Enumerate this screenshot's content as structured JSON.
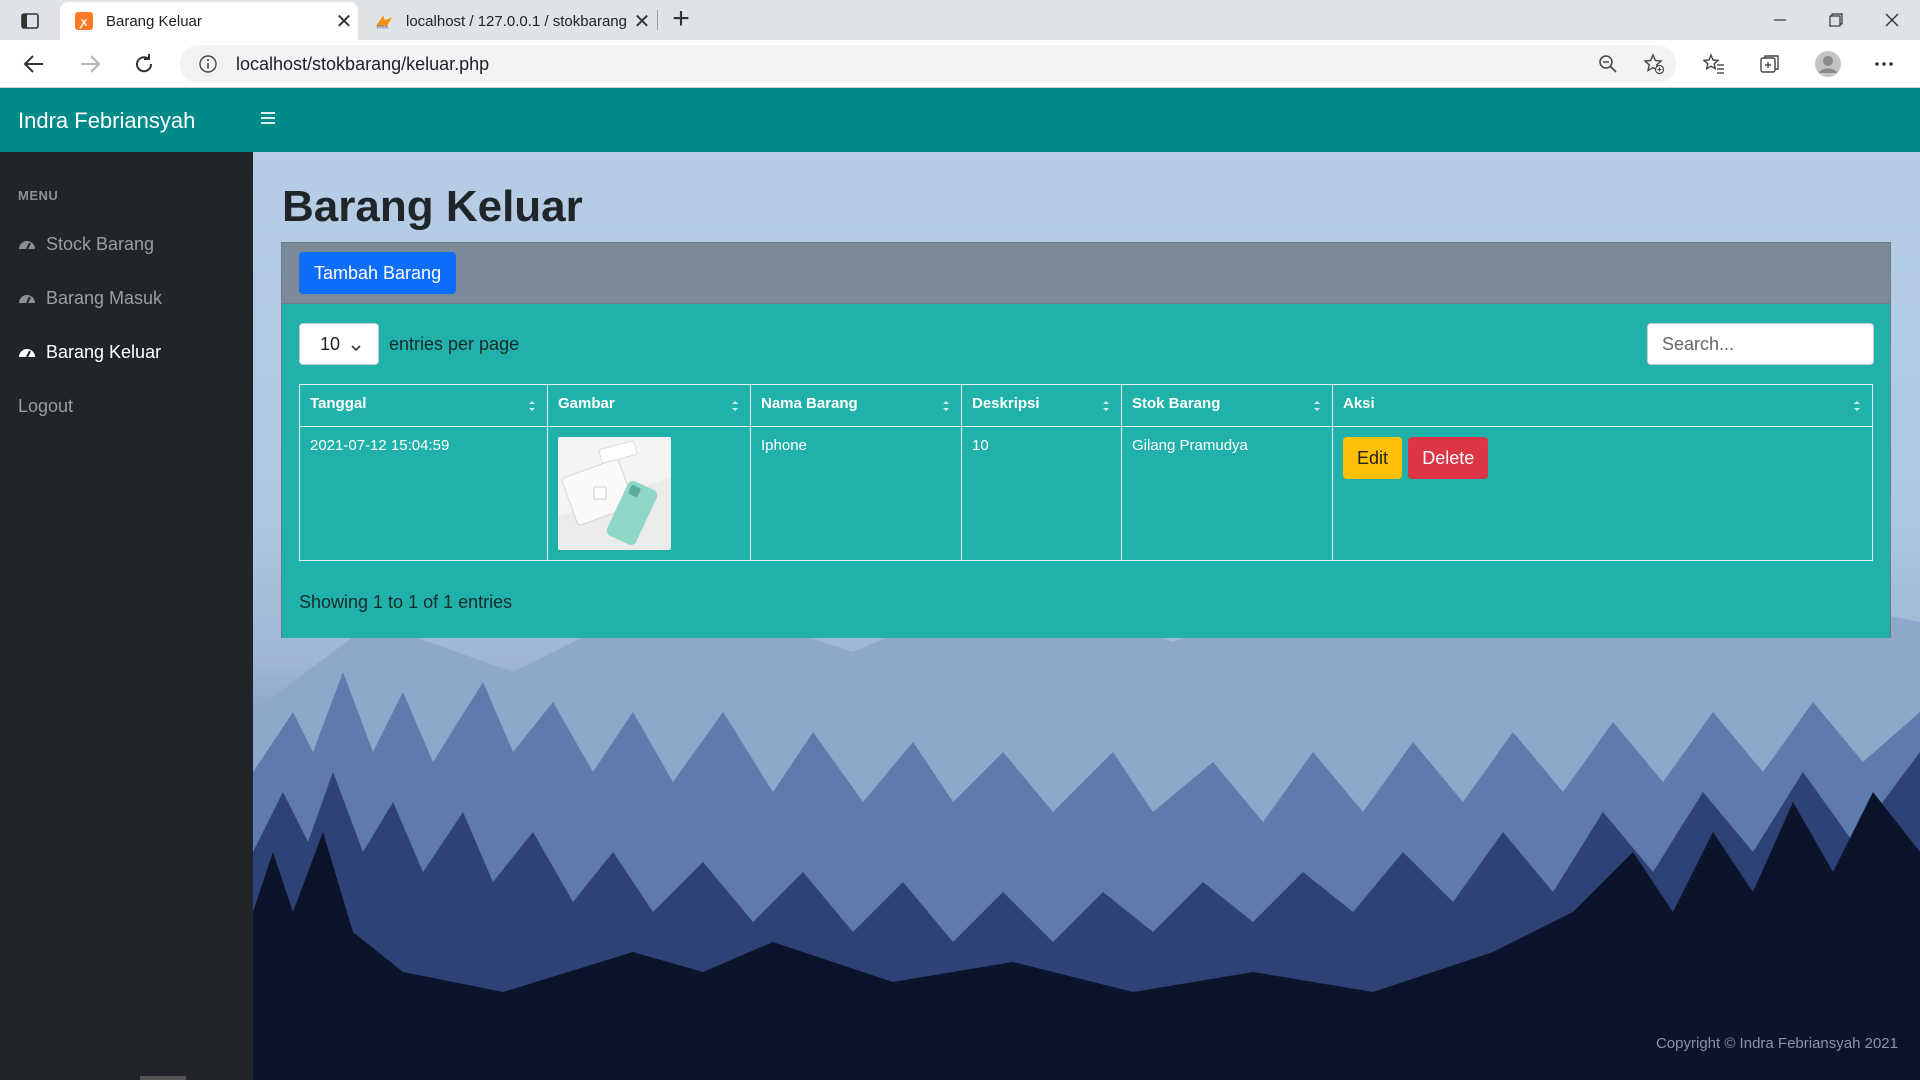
{
  "browser": {
    "tabs": [
      {
        "title": "Barang Keluar",
        "active": true
      },
      {
        "title": "localhost / 127.0.0.1 / stokbarang",
        "active": false
      }
    ],
    "url": "localhost/stokbarang/keluar.php"
  },
  "app": {
    "brand": "Indra Febriansyah"
  },
  "sidebar": {
    "heading": "MENU",
    "items": [
      {
        "label": "Stock Barang",
        "active": false
      },
      {
        "label": "Barang Masuk",
        "active": false
      },
      {
        "label": "Barang Keluar",
        "active": true
      },
      {
        "label": "Logout",
        "active": false
      }
    ]
  },
  "main": {
    "title": "Barang Keluar",
    "add_button": "Tambah Barang",
    "per_page_value": "10",
    "per_page_label": "entries per page",
    "search_placeholder": "Search...",
    "table": {
      "headers": [
        "Tanggal",
        "Gambar",
        "Nama Barang",
        "Deskripsi",
        "Stok Barang",
        "Aksi"
      ],
      "rows": [
        {
          "tanggal": "2021-07-12 15:04:59",
          "nama_barang": "Iphone",
          "deskripsi": "10",
          "stok_barang": "Gilang Pramudya",
          "edit_label": "Edit",
          "delete_label": "Delete"
        }
      ]
    },
    "showing": "Showing 1 to 1 of 1 entries"
  },
  "footer": {
    "copyright": "Copyright © Indra Febriansyah 2021"
  },
  "colors": {
    "topnav": "#008a8a",
    "sidebar": "#212529",
    "card_body": "#20b2aa",
    "primary": "#0d6efd",
    "warning": "#ffc107",
    "danger": "#dc3545"
  }
}
